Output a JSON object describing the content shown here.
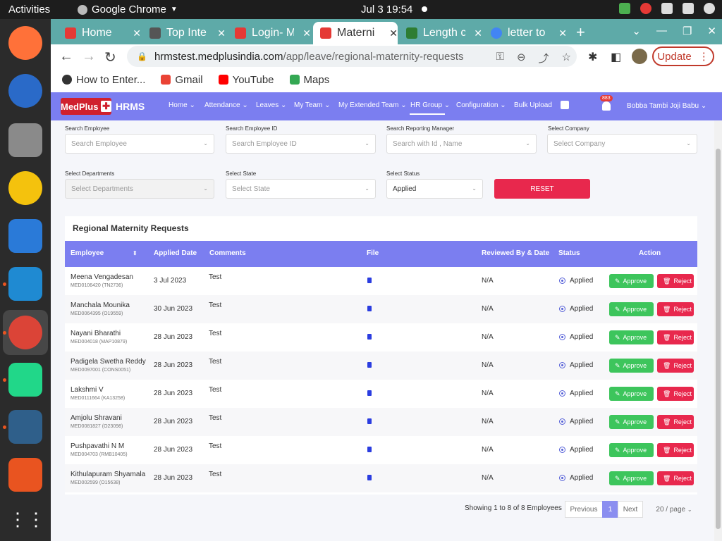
{
  "os": {
    "activities": "Activities",
    "app": "Google Chrome",
    "clock": "Jul 3  19:54"
  },
  "browser": {
    "tabs": [
      {
        "title": "Home",
        "color": "#e53935"
      },
      {
        "title": "Top Inte",
        "color": "#555555"
      },
      {
        "title": "Login- M",
        "color": "#e53935"
      },
      {
        "title": "Materni",
        "color": "#e53935"
      },
      {
        "title": "Length c",
        "color": "#2e7d32"
      },
      {
        "title": "letter to",
        "color": "#4285f4"
      }
    ],
    "url_host": "hrmstest.medplusindia.com",
    "url_path": "/app/leave/regional-maternity-requests",
    "update_label": "Update",
    "bookmarks": [
      {
        "label": "How to Enter...",
        "color": "#333333"
      },
      {
        "label": "Gmail",
        "color": "#ea4335"
      },
      {
        "label": "YouTube",
        "color": "#ff0000"
      },
      {
        "label": "Maps",
        "color": "#34a853"
      }
    ]
  },
  "app": {
    "logo": "MedPlus",
    "name": "HRMS",
    "nav": [
      "Home",
      "Attendance",
      "Leaves",
      "My Team",
      "My Extended Team",
      "HR Group",
      "Configuration",
      "Bulk Upload"
    ],
    "notif_count": "883",
    "user": "Bobba Tambi Joji Babu"
  },
  "filters": {
    "search_employee": {
      "label": "Search Employee",
      "placeholder": "Search Employee"
    },
    "search_employee_id": {
      "label": "Search Employee ID",
      "placeholder": "Search Employee ID"
    },
    "search_manager": {
      "label": "Search Reporting Manager",
      "placeholder": "Search with Id , Name"
    },
    "company": {
      "label": "Select Company",
      "placeholder": "Select Company"
    },
    "departments": {
      "label": "Select Departments",
      "placeholder": "Select Departments"
    },
    "state": {
      "label": "Select State",
      "placeholder": "Select State"
    },
    "status": {
      "label": "Select Status",
      "value": "Applied"
    },
    "reset_label": "RESET"
  },
  "table": {
    "title": "Regional Maternity Requests",
    "columns": [
      "Employee",
      "Applied Date",
      "Comments",
      "File",
      "Reviewed By & Date",
      "Status",
      "Action"
    ],
    "approve_label": "Approve",
    "reject_label": "Reject",
    "rows": [
      {
        "name": "Meena Vengadesan",
        "id": "MED0106420 (TN2736)",
        "date": "3 Jul 2023",
        "comment": "Test",
        "reviewed": "N/A",
        "status": "Applied"
      },
      {
        "name": "Manchala Mounika",
        "id": "MED0064395 (O19559)",
        "date": "30 Jun 2023",
        "comment": "Test",
        "reviewed": "N/A",
        "status": "Applied"
      },
      {
        "name": "Nayani Bharathi",
        "id": "MED004018 (MAP10879)",
        "date": "28 Jun 2023",
        "comment": "Test",
        "reviewed": "N/A",
        "status": "Applied"
      },
      {
        "name": "Padigela Swetha Reddy",
        "id": "MED0097001 (CONS0051)",
        "date": "28 Jun 2023",
        "comment": "Test",
        "reviewed": "N/A",
        "status": "Applied"
      },
      {
        "name": "Lakshmi V",
        "id": "MED0111664 (KA13258)",
        "date": "28 Jun 2023",
        "comment": "Test",
        "reviewed": "N/A",
        "status": "Applied"
      },
      {
        "name": "Amjolu Shravani",
        "id": "MED0081827 (O23098)",
        "date": "28 Jun 2023",
        "comment": "Test",
        "reviewed": "N/A",
        "status": "Applied"
      },
      {
        "name": "Pushpavathi N M",
        "id": "MED004703 (RMB10405)",
        "date": "28 Jun 2023",
        "comment": "Test",
        "reviewed": "N/A",
        "status": "Applied"
      },
      {
        "name": "Kithulapuram Shyamala",
        "id": "MED002599 (O15638)",
        "date": "28 Jun 2023",
        "comment": "Test",
        "reviewed": "N/A",
        "status": "Applied"
      }
    ]
  },
  "pagination": {
    "summary": "Showing 1 to 8 of 8 Employees",
    "previous": "Previous",
    "current": "1",
    "next": "Next",
    "page_size": "20 / page"
  }
}
